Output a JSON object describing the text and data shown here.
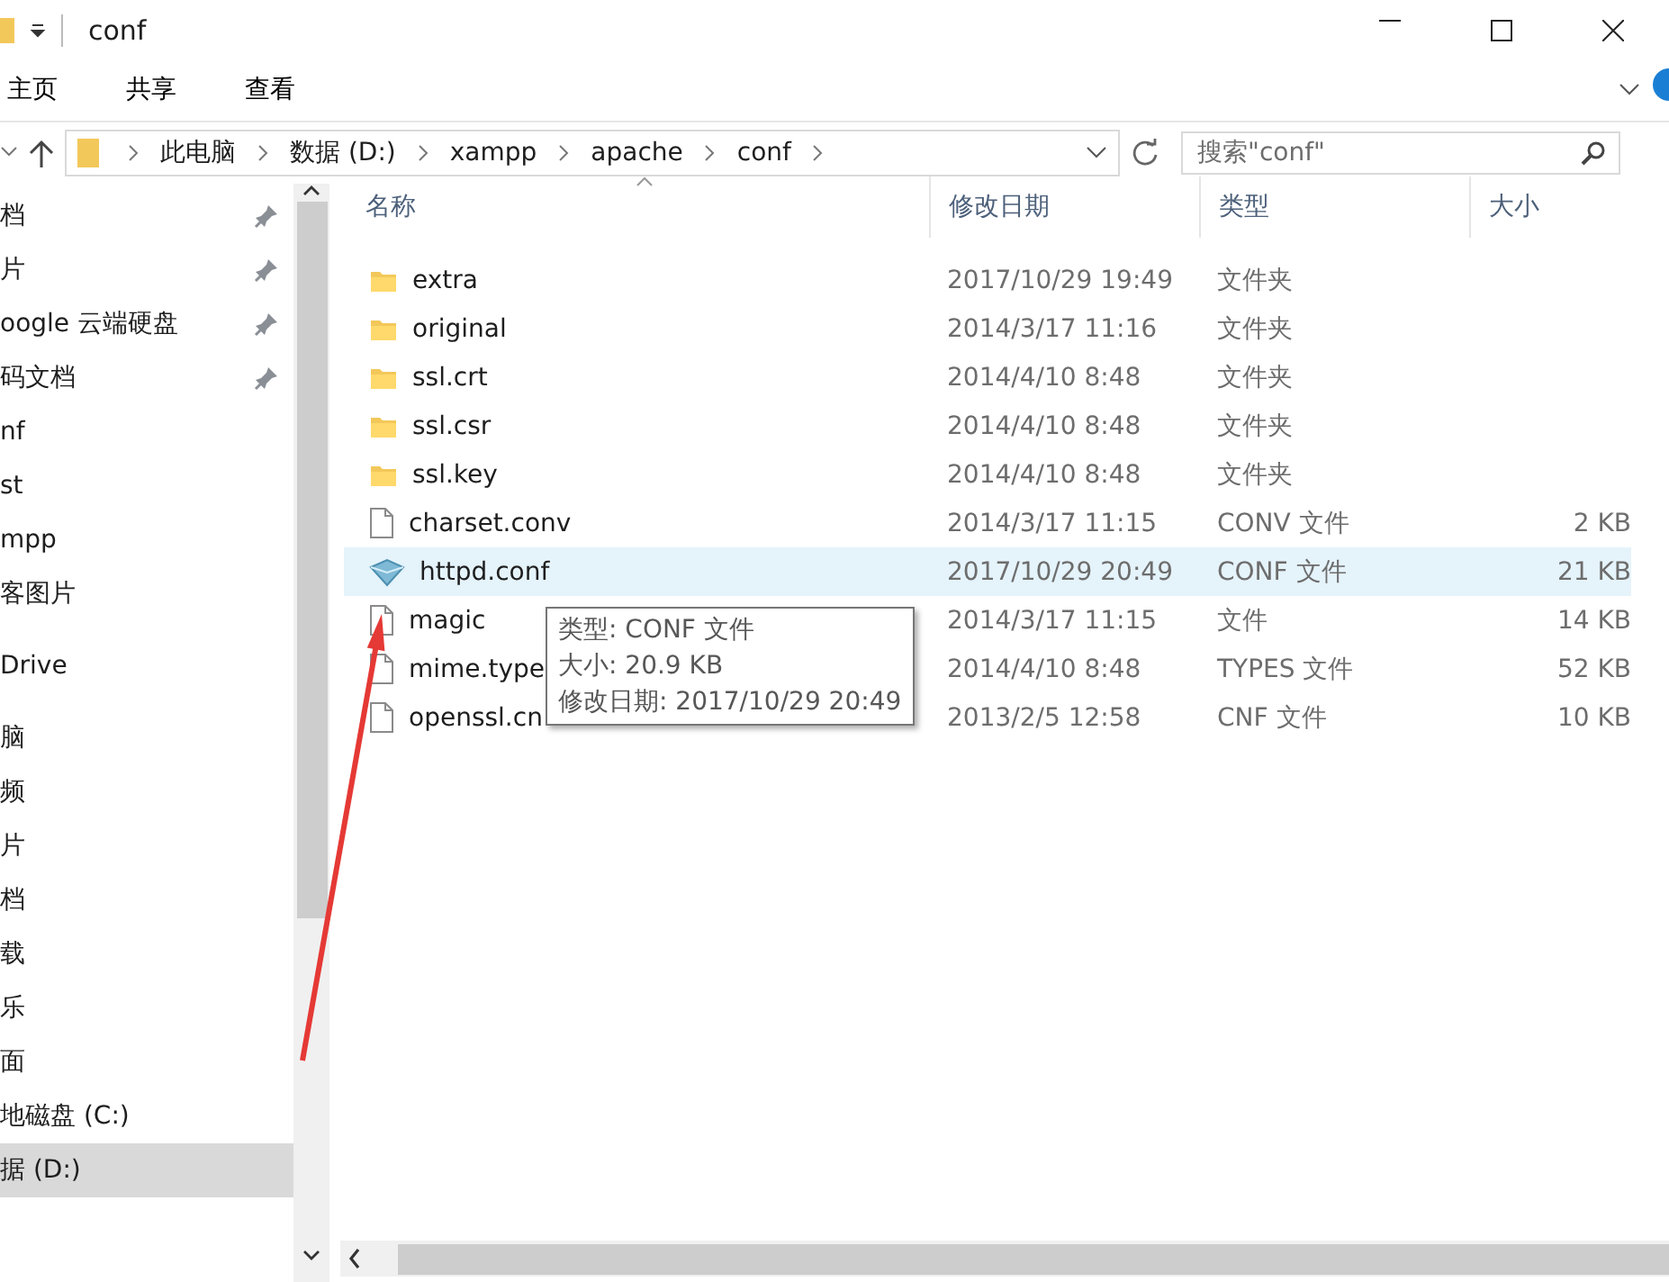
{
  "window": {
    "title": "conf"
  },
  "ribbon_tabs": [
    {
      "label": "主页",
      "selected": false
    },
    {
      "label": "共享",
      "selected": false
    },
    {
      "label": "查看",
      "selected": false
    }
  ],
  "address_bar": {
    "crumbs": [
      "此电脑",
      "数据 (D:)",
      "xampp",
      "apache",
      "conf"
    ]
  },
  "search": {
    "placeholder": "搜索\"conf\""
  },
  "sidebar": {
    "items": [
      {
        "label": "档",
        "pinned": true,
        "selected": false
      },
      {
        "label": "片",
        "pinned": true,
        "selected": false
      },
      {
        "label": "oogle 云端硬盘",
        "pinned": true,
        "selected": false
      },
      {
        "label": "码文档",
        "pinned": true,
        "selected": false
      },
      {
        "label": "nf",
        "pinned": false,
        "selected": false
      },
      {
        "label": "st",
        "pinned": false,
        "selected": false
      },
      {
        "label": "mpp",
        "pinned": false,
        "selected": false
      },
      {
        "label": "客图片",
        "pinned": false,
        "selected": false
      },
      {
        "label": "Drive",
        "pinned": false,
        "selected": false,
        "gap": true
      },
      {
        "label": "脑",
        "pinned": false,
        "selected": false,
        "gap": true
      },
      {
        "label": "频",
        "pinned": false,
        "selected": false
      },
      {
        "label": "片",
        "pinned": false,
        "selected": false
      },
      {
        "label": "档",
        "pinned": false,
        "selected": false
      },
      {
        "label": "载",
        "pinned": false,
        "selected": false
      },
      {
        "label": "乐",
        "pinned": false,
        "selected": false
      },
      {
        "label": "面",
        "pinned": false,
        "selected": false
      },
      {
        "label": "地磁盘 (C:)",
        "pinned": false,
        "selected": false
      },
      {
        "label": "据 (D:)",
        "pinned": false,
        "selected": true
      }
    ]
  },
  "table": {
    "columns": [
      "名称",
      "修改日期",
      "类型",
      "大小"
    ],
    "rows": [
      {
        "kind": "folder",
        "name": "extra",
        "date": "2017/10/29 19:49",
        "type": "文件夹",
        "size": "",
        "selected": false
      },
      {
        "kind": "folder",
        "name": "original",
        "date": "2014/3/17 11:16",
        "type": "文件夹",
        "size": "",
        "selected": false
      },
      {
        "kind": "folder",
        "name": "ssl.crt",
        "date": "2014/4/10 8:48",
        "type": "文件夹",
        "size": "",
        "selected": false
      },
      {
        "kind": "folder",
        "name": "ssl.csr",
        "date": "2014/4/10 8:48",
        "type": "文件夹",
        "size": "",
        "selected": false
      },
      {
        "kind": "folder",
        "name": "ssl.key",
        "date": "2014/4/10 8:48",
        "type": "文件夹",
        "size": "",
        "selected": false
      },
      {
        "kind": "file",
        "name": "charset.conv",
        "date": "2014/3/17 11:15",
        "type": "CONV 文件",
        "size": "2 KB",
        "selected": false
      },
      {
        "kind": "conf",
        "name": "httpd.conf",
        "date": "2017/10/29 20:49",
        "type": "CONF 文件",
        "size": "21 KB",
        "selected": true
      },
      {
        "kind": "file",
        "name": "magic",
        "date": "2014/3/17 11:15",
        "type": "文件",
        "size": "14 KB",
        "selected": false
      },
      {
        "kind": "file",
        "name": "mime.type",
        "date": "2014/4/10 8:48",
        "type": "TYPES 文件",
        "size": "52 KB",
        "selected": false
      },
      {
        "kind": "file",
        "name": "openssl.cn",
        "date": "2013/2/5 12:58",
        "type": "CNF 文件",
        "size": "10 KB",
        "selected": false
      }
    ]
  },
  "tooltip": {
    "lines": [
      "类型: CONF 文件",
      "大小: 20.9 KB",
      "修改日期: 2017/10/29 20:49"
    ]
  }
}
